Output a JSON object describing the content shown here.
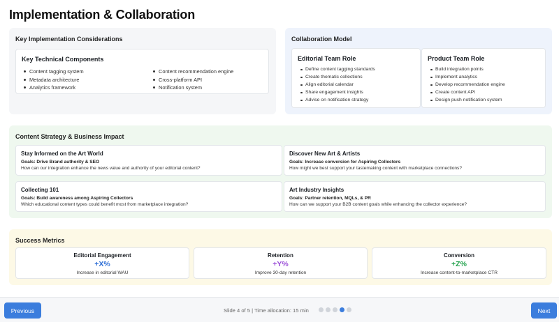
{
  "title": "Implementation & Collaboration",
  "implementation": {
    "heading": "Key Implementation Considerations",
    "card_title": "Key Technical Components",
    "items_col1": [
      "Content tagging system",
      "Metadata architecture",
      "Analytics framework"
    ],
    "items_col2": [
      "Content recommendation engine",
      "Cross-platform API",
      "Notification system"
    ]
  },
  "collaboration": {
    "heading": "Collaboration Model",
    "editorial": {
      "title": "Editorial Team Role",
      "items": [
        "Define content tagging standards",
        "Create thematic collections",
        "Align editorial calendar",
        "Share engagement insights",
        "Advise on notification strategy"
      ]
    },
    "product": {
      "title": "Product Team Role",
      "items": [
        "Build integration points",
        "Implement analytics",
        "Develop recommendation engine",
        "Create content API",
        "Design push notification system"
      ]
    }
  },
  "strategy": {
    "heading": "Content Strategy & Business Impact",
    "cards": [
      {
        "title": "Stay Informed on the Art World",
        "goal": "Goals: Drive Brand authority & SEO",
        "question": "How can our integration enhance the news value and authority of your editorial content?"
      },
      {
        "title": "Discover New Art & Artists",
        "goal": "Goals: Increase conversion for Aspiring Collectors",
        "question": "How might we best support your tastemaking content with marketplace connections?"
      },
      {
        "title": "Collecting 101",
        "goal": "Goals: Build awareness among Aspiring Collectors",
        "question": "Which educational content types could benefit most from marketplace integration?"
      },
      {
        "title": "Art Industry Insights",
        "goal": "Goals: Partner retention, MQLs, & PR",
        "question": "How can we support your B2B content goals while enhancing the collector experience?"
      }
    ]
  },
  "metrics": {
    "heading": "Success Metrics",
    "cards": [
      {
        "title": "Editorial Engagement",
        "value": "+X%",
        "desc": "Increase in editorial WAU",
        "color": "#2f6fd6"
      },
      {
        "title": "Retention",
        "value": "+Y%",
        "desc": "Improve 30-day retention",
        "color": "#9b4fd8"
      },
      {
        "title": "Conversion",
        "value": "+Z%",
        "desc": "Increase content-to-marketplace CTR",
        "color": "#23a24d"
      }
    ]
  },
  "footer": {
    "prev_label": "Previous",
    "next_label": "Next",
    "status": "Slide 4 of 5 | Time allocation: 15 min",
    "total_slides": 5,
    "current_slide": 4
  }
}
